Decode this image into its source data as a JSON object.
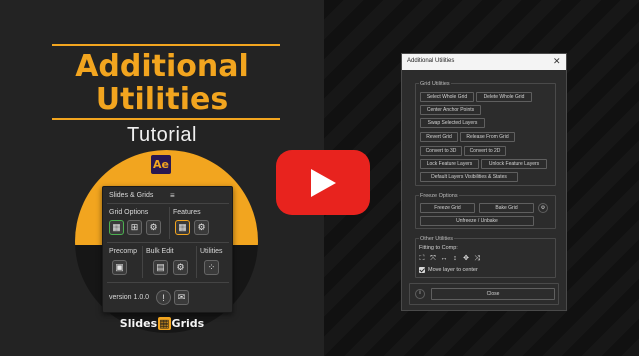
{
  "thumbnail": {
    "title_line1": "Additional",
    "title_line2": "Utilities",
    "subtitle": "Tutorial",
    "ae_badge": "Ae",
    "brand_left": "Slides",
    "brand_right": "Grids",
    "accent_color": "#f2a51f",
    "panel": {
      "header": "Slides & Grids",
      "menu_icon": "≡",
      "grid_options": "Grid Options",
      "features": "Features",
      "precomp": "Precomp",
      "bulk_edit": "Bulk Edit",
      "utilities": "Utilities",
      "version": "version 1.0.0"
    }
  },
  "youtube": {
    "icon": "play-icon",
    "color": "#e8231e"
  },
  "dialog": {
    "title": "Additional Utilities",
    "close_glyph": "✕",
    "grid_utilities": {
      "label": "Grid Utilities",
      "select_whole_grid": "Select Whole Grid",
      "delete_whole_grid": "Delete Whole Grid",
      "center_anchor_points": "Center Anchor Points",
      "swap_selected_layers": "Swap Selected Layers",
      "revert_grid": "Revert Grid",
      "release_from_grid": "Release From Grid",
      "convert_to_3d": "Convert to 3D",
      "convert_to_2d": "Convert to 2D",
      "lock_feature_layers": "Lock Feature Layers",
      "unlock_feature_layers": "Unlock Feature Layers",
      "default_layers": "Default Layers Visibilities & States"
    },
    "freeze_options": {
      "label": "Freeze Options",
      "freeze_grid": "Freeze Grid",
      "bake_grid": "Bake Grid",
      "unfreeze_unbake": "Unfreeze / Unbake"
    },
    "other_utilities": {
      "label": "Other Utilities",
      "fitting_to_comp": "Fitting to Comp:",
      "move_layer_to_center": "Move layer to center",
      "move_layer_checked": true
    },
    "footer": {
      "info_glyph": "i",
      "close": "Close"
    }
  }
}
